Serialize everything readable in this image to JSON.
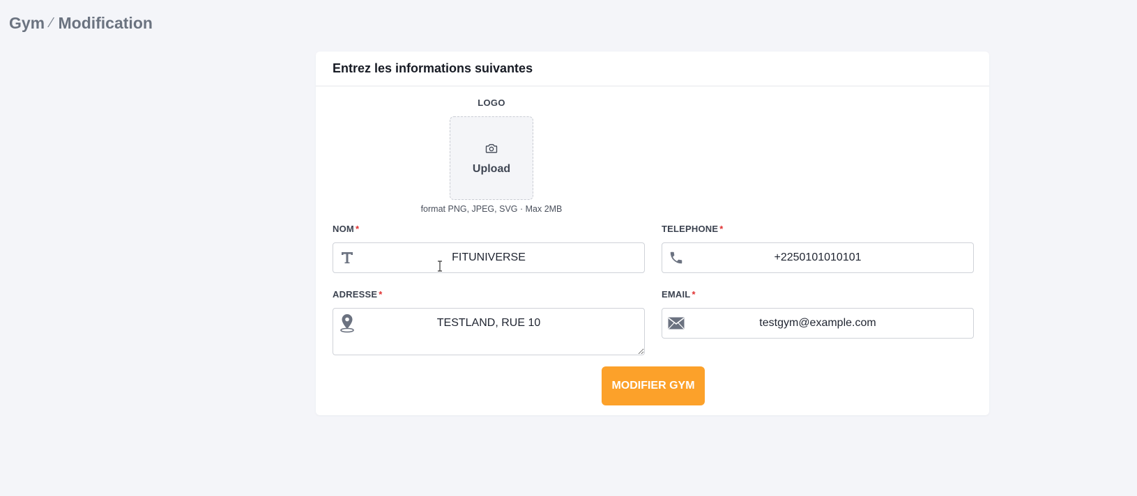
{
  "breadcrumb": {
    "parent": "Gym",
    "separator": "⁄",
    "current": "Modification"
  },
  "form": {
    "header": "Entrez les informations suivantes",
    "logo": {
      "label": "LOGO",
      "upload_text": "Upload",
      "upload_icon": "camera-icon",
      "hint": "format PNG, JPEG, SVG · Max 2MB"
    },
    "fields": {
      "nom": {
        "label": "NOM",
        "required": "*",
        "value": "FITUNIVERSE",
        "icon": "text-icon"
      },
      "telephone": {
        "label": "TELEPHONE",
        "required": "*",
        "value": "+2250101010101",
        "icon": "phone-icon"
      },
      "adresse": {
        "label": "ADRESSE",
        "required": "*",
        "value": "TESTLAND, RUE 10",
        "icon": "map-pin-icon"
      },
      "email": {
        "label": "EMAIL",
        "required": "*",
        "value": "testgym@example.com",
        "icon": "envelope-icon"
      }
    },
    "submit_label": "MODIFIER GYM"
  },
  "colors": {
    "background": "#f4f5f9",
    "accent": "#fca12a",
    "required": "#e03131",
    "icon": "#6b7280"
  }
}
